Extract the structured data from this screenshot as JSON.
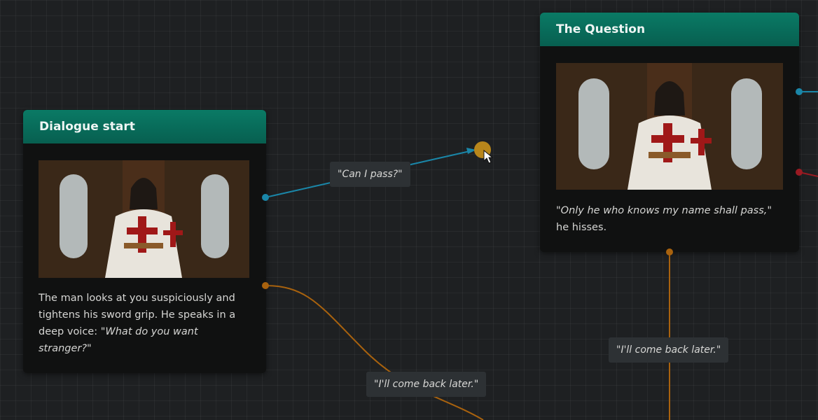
{
  "nodes": {
    "dialogue_start": {
      "title": "Dialogue start",
      "image_alt": "knight-templar-portrait",
      "text_plain": "The man looks at you suspiciously and tightens his sword grip. He speaks in a deep voice: ",
      "text_quote": "\"What do you want stranger?\""
    },
    "the_question": {
      "title": "The Question",
      "image_alt": "knight-templar-portrait",
      "text_quote": "\"Only he who knows my name shall pass,\"",
      "text_plain": " he hisses."
    }
  },
  "edges": {
    "can_i_pass": "\"Can I pass?\"",
    "come_back_left": "\"I'll come back later.\"",
    "come_back_right": "\"I'll come back later.\""
  },
  "colors": {
    "background": "#1e2022",
    "grid": "#2a2d2f",
    "node_body": "#101111",
    "node_header": "#0a7a65",
    "wire_blue": "#1a86a8",
    "wire_orange": "#a8620e",
    "wire_red": "#9a1a22",
    "drag_handle": "#b8861b"
  }
}
